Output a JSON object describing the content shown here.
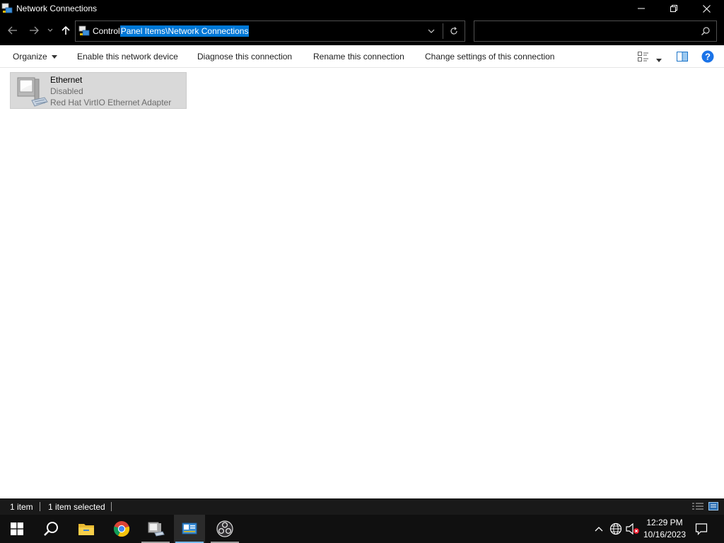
{
  "window": {
    "title": "Network Connections",
    "controls": {
      "minimize": "—",
      "restore": "❐",
      "close": "✕"
    }
  },
  "nav": {
    "back_icon": "back-arrow-icon",
    "forward_icon": "forward-arrow-icon",
    "recent_icon": "chevron-down-icon",
    "up_icon": "up-arrow-icon"
  },
  "address": {
    "path_prefix": "Control",
    "path_selected": " Panel Items\\Network Connections",
    "dropdown_icon": "chevron-down-icon",
    "refresh_icon": "refresh-icon"
  },
  "search": {
    "value": "",
    "placeholder": ""
  },
  "commands": {
    "organize": "Organize",
    "enable": "Enable this network device",
    "diagnose": "Diagnose this connection",
    "rename": "Rename this connection",
    "change_settings": "Change settings of this connection"
  },
  "connections": [
    {
      "name": "Ethernet",
      "status": "Disabled",
      "device": "Red Hat VirtIO Ethernet Adapter",
      "selected": true
    }
  ],
  "status_bar": {
    "item_count": "1 item",
    "selected_count": "1 item selected"
  },
  "taskbar": {
    "apps": [
      "start-icon",
      "search-icon",
      "file-explorer-icon",
      "chrome-icon",
      "network-connections-icon",
      "control-panel-icon",
      "obs-icon"
    ],
    "clock_time": "12:29 PM",
    "clock_date": "10/16/2023"
  },
  "colors": {
    "selection": "#0078d7",
    "help": "#1a73e8",
    "item_selected_bg": "#d9d9d9",
    "taskbar": "#101010"
  }
}
